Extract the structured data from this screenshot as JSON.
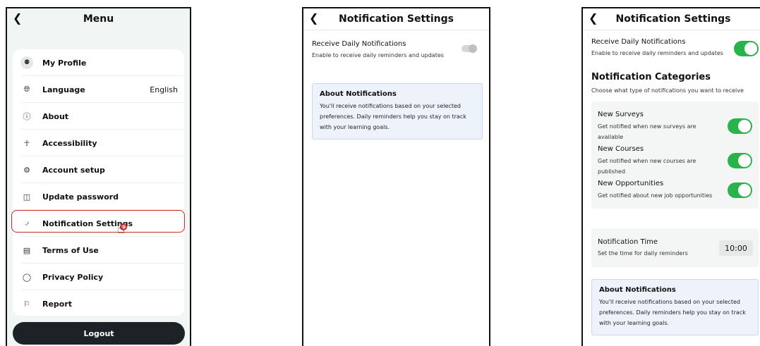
{
  "menu": {
    "title": "Menu",
    "items": [
      {
        "label": "My Profile",
        "icon": "user-icon",
        "value": ""
      },
      {
        "label": "Language",
        "icon": "globe-icon",
        "value": "English"
      },
      {
        "label": "About",
        "icon": "info-icon",
        "value": ""
      },
      {
        "label": "Accessibility",
        "icon": "accessibility-icon",
        "value": ""
      },
      {
        "label": "Account setup",
        "icon": "gear-icon",
        "value": ""
      },
      {
        "label": "Update password",
        "icon": "lock-icon",
        "value": ""
      },
      {
        "label": "Notification Settings",
        "icon": "bell-icon",
        "value": ""
      },
      {
        "label": "Terms of Use",
        "icon": "document-icon",
        "value": ""
      },
      {
        "label": "Privacy Policy",
        "icon": "shield-icon",
        "value": ""
      },
      {
        "label": "Report",
        "icon": "flag-icon",
        "value": ""
      }
    ],
    "logout_label": "Logout"
  },
  "settings_a": {
    "title": "Notification Settings",
    "daily_title": "Receive Daily Notifications",
    "daily_sub": "Enable to receive daily reminders and updates",
    "daily_enabled": false,
    "about_title": "About Notifications",
    "about_body": "You'll receive notifications based on your selected preferences. Daily reminders help you stay on track with your learning goals."
  },
  "settings_b": {
    "title": "Notification Settings",
    "daily_title": "Receive Daily Notifications",
    "daily_sub": "Enable to receive daily reminders and updates",
    "daily_enabled": true,
    "categories_title": "Notification Categories",
    "categories_sub": "Choose what type of notifications you want to receive",
    "categories": [
      {
        "title": "New Surveys",
        "sub": "Get notified when new surveys are available",
        "enabled": true
      },
      {
        "title": "New Courses",
        "sub": "Get notified when new courses are published",
        "enabled": true
      },
      {
        "title": "New Opportunities",
        "sub": "Get notified about new job opportunities",
        "enabled": true
      }
    ],
    "time_title": "Notification Time",
    "time_sub": "Set the time for daily reminders",
    "time_value": "10:00",
    "about_title": "About Notifications",
    "about_body": "You'll receive notifications based on your selected preferences. Daily reminders help you stay on track with your learning goals."
  },
  "colors": {
    "toggle_on": "#28b44b",
    "highlight": "#d12a2a",
    "about_bg": "#eef3fb"
  }
}
